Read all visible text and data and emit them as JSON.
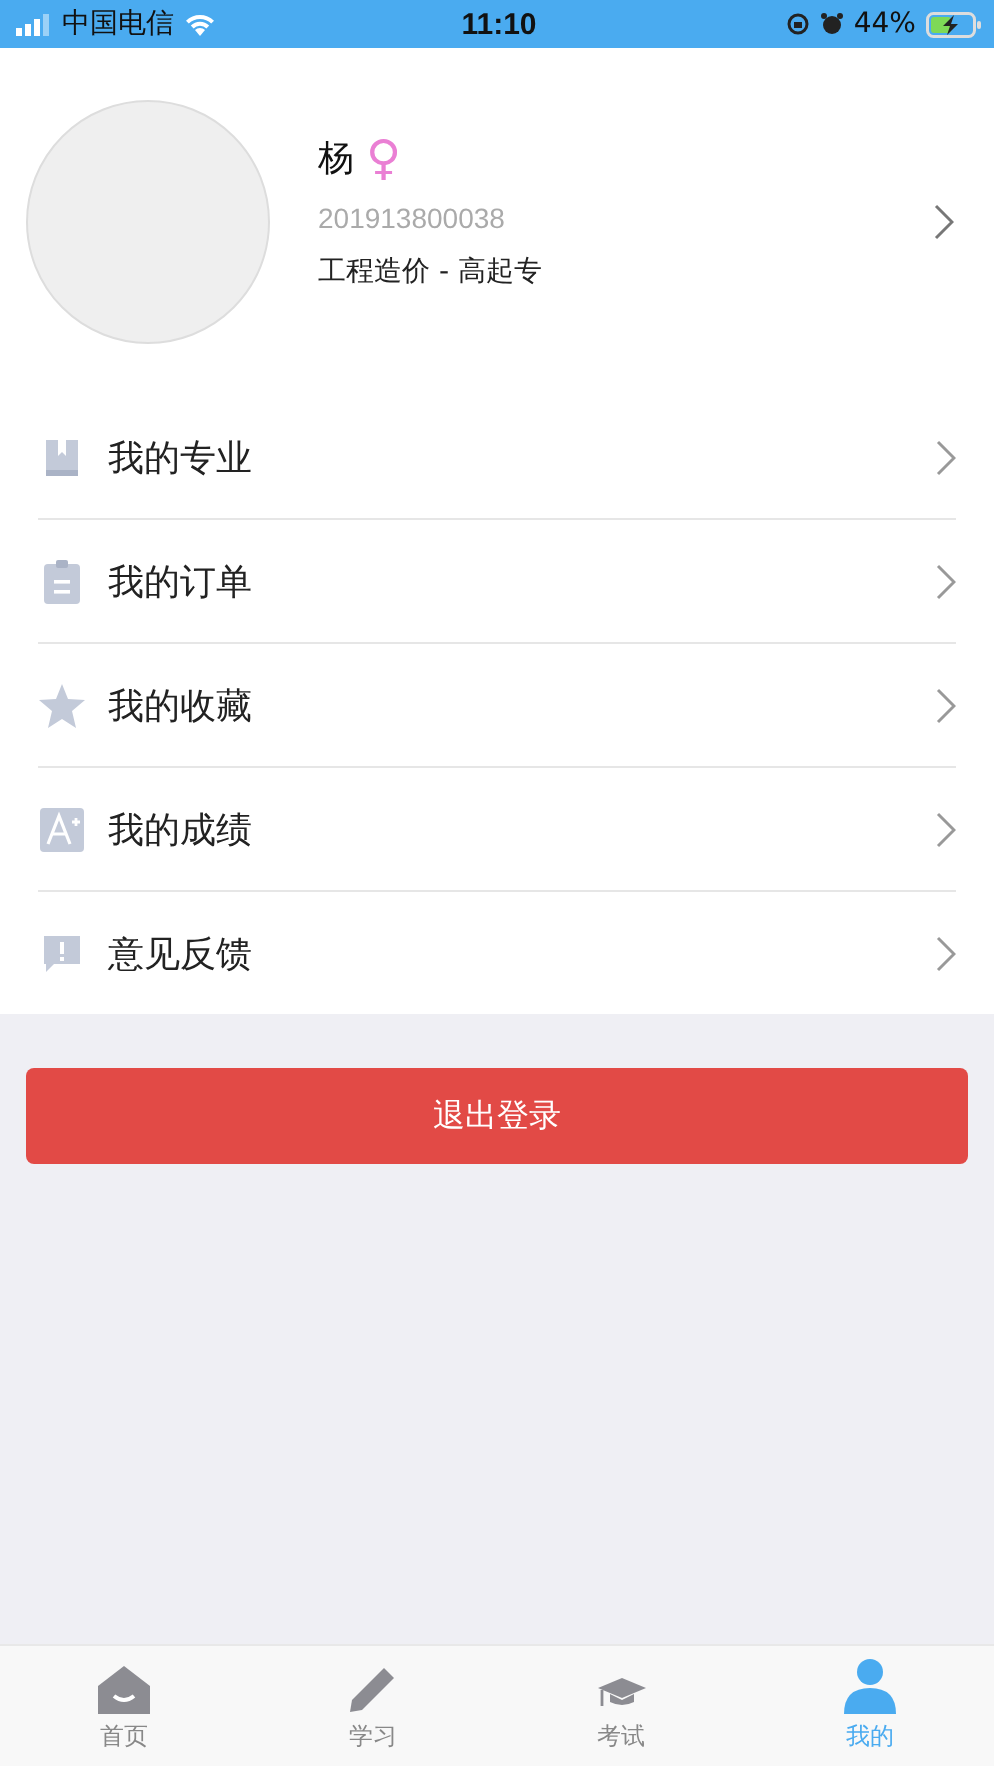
{
  "status_bar": {
    "carrier": "中国电信",
    "time": "11:10",
    "battery": "44%"
  },
  "profile": {
    "name": "杨",
    "gender_symbol": "♀",
    "student_id": "201913800038",
    "program": "工程造价 - 高起专"
  },
  "menu": [
    {
      "kind": "major",
      "label": "我的专业"
    },
    {
      "kind": "order",
      "label": "我的订单"
    },
    {
      "kind": "favorite",
      "label": "我的收藏"
    },
    {
      "kind": "grades",
      "label": "我的成绩"
    },
    {
      "kind": "feedback",
      "label": "意见反馈"
    }
  ],
  "logout_button": "退出登录",
  "tabs": [
    {
      "kind": "home",
      "label": "首页",
      "selected": false
    },
    {
      "kind": "study",
      "label": "学习",
      "selected": false
    },
    {
      "kind": "exam",
      "label": "考试",
      "selected": false
    },
    {
      "kind": "mine",
      "label": "我的",
      "selected": true
    }
  ]
}
